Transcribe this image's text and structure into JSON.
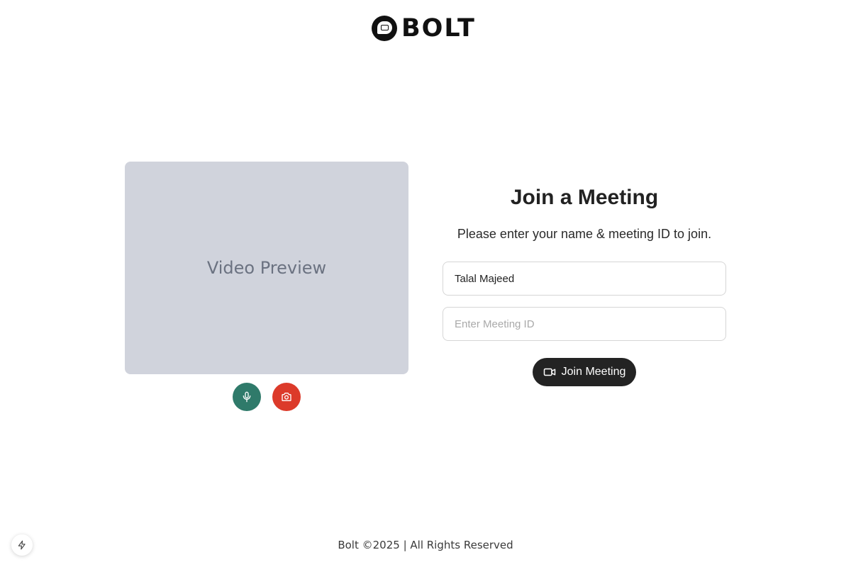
{
  "brand": {
    "name": "BOLT"
  },
  "preview": {
    "label": "Video Preview"
  },
  "controls": {
    "mic": {
      "icon": "microphone-icon",
      "color": "#2f7a6a"
    },
    "camera": {
      "icon": "camera-icon",
      "color": "#dc3a2a"
    }
  },
  "form": {
    "title": "Join a Meeting",
    "subtitle": "Please enter your name & meeting ID to join.",
    "name_value": "Talal Majeed",
    "meeting_placeholder": "Enter Meeting ID",
    "join_label": "Join Meeting"
  },
  "footer": {
    "text": "Bolt ©2025 | All Rights Reserved"
  }
}
